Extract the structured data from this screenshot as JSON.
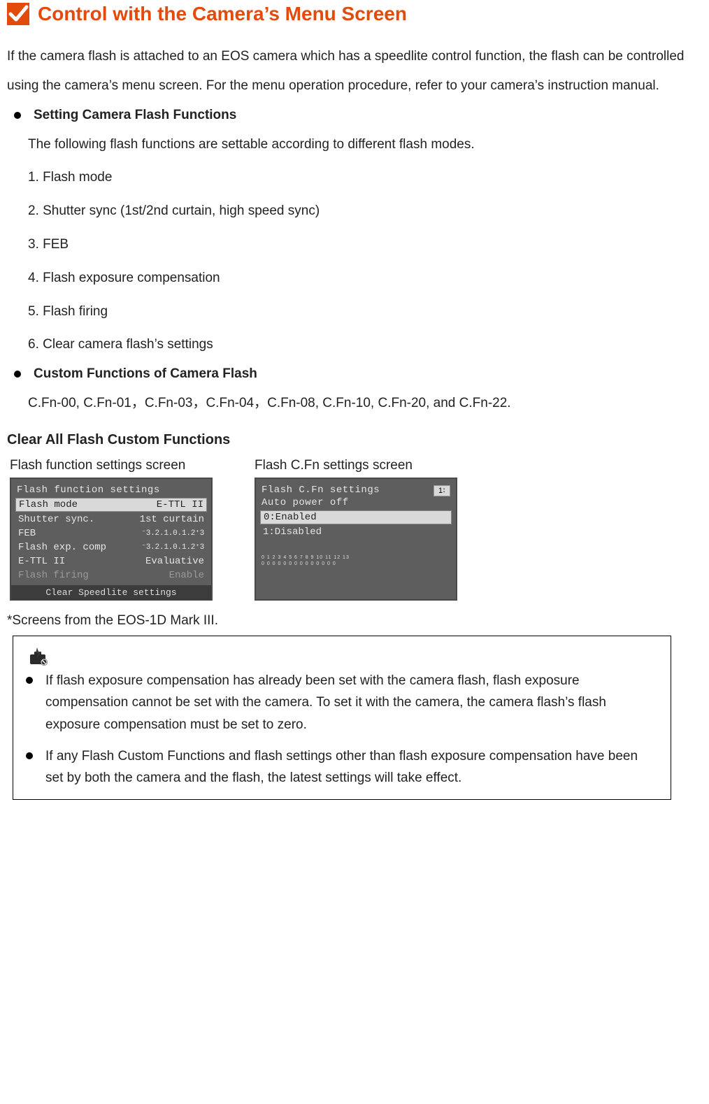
{
  "title": "Control with the Camera’s Menu Screen",
  "intro": "If the camera flash is attached to an EOS camera which has a speedlite control function, the flash can be controlled using the camera’s menu screen. For the menu operation procedure, refer to your camera’s instruction manual.",
  "section1": {
    "heading": "Setting Camera Flash Functions",
    "lead": "The following flash functions are settable according to different flash modes.",
    "items": [
      "1. Flash mode",
      "2. Shutter sync (1st/2nd curtain, high speed sync)",
      "3. FEB",
      "4. Flash exposure compensation",
      "5. Flash firing",
      "6. Clear camera flash’s settings"
    ]
  },
  "section2": {
    "heading": "Custom Functions of Camera Flash",
    "body": "C.Fn-00, C.Fn-01，C.Fn-03，C.Fn-04，C.Fn-08, C.Fn-10, C.Fn-20, and C.Fn-22."
  },
  "clear_heading": "Clear All Flash Custom Functions",
  "screens": {
    "left_caption": "Flash function settings screen",
    "right_caption": "Flash C.Fn settings screen",
    "left": {
      "title": "Flash function settings",
      "rows": [
        {
          "label": "Flash mode",
          "value": "E-TTL II",
          "sel": true
        },
        {
          "label": "Shutter sync.",
          "value": "1st curtain"
        },
        {
          "label": "FEB",
          "value": "⁻3.2.1.0.1.2⁺3"
        },
        {
          "label": "Flash exp. comp",
          "value": "⁻3.2.1.0.1.2⁺3"
        },
        {
          "label": "E-TTL II",
          "value": "Evaluative"
        },
        {
          "label": "Flash firing",
          "value": "Enable",
          "dis": true
        }
      ],
      "footer": "Clear Speedlite settings"
    },
    "right": {
      "title": "Flash C.Fn settings",
      "badge": "1∶",
      "subtitle": "Auto power off",
      "opt0": "0:Enabled",
      "opt1": "1:Disabled",
      "scale_top": "0 1 2 3 4 5 6 7 8 9 10 11 12 13",
      "scale_bot": "0 0 0 0 0 0 0 0 0 0  0  0  0  0"
    }
  },
  "footnote": "*Screens from the EOS-1D Mark III.",
  "notes": {
    "n1": "If flash exposure compensation has already been set with the camera flash, flash exposure compensation cannot be set with the camera. To set it with the camera, the camera flash’s flash exposure compensation must be set to zero.",
    "n2": "If any Flash Custom Functions and flash settings other than flash exposure compensation have been set by both the camera and the flash, the latest settings will take effect."
  }
}
